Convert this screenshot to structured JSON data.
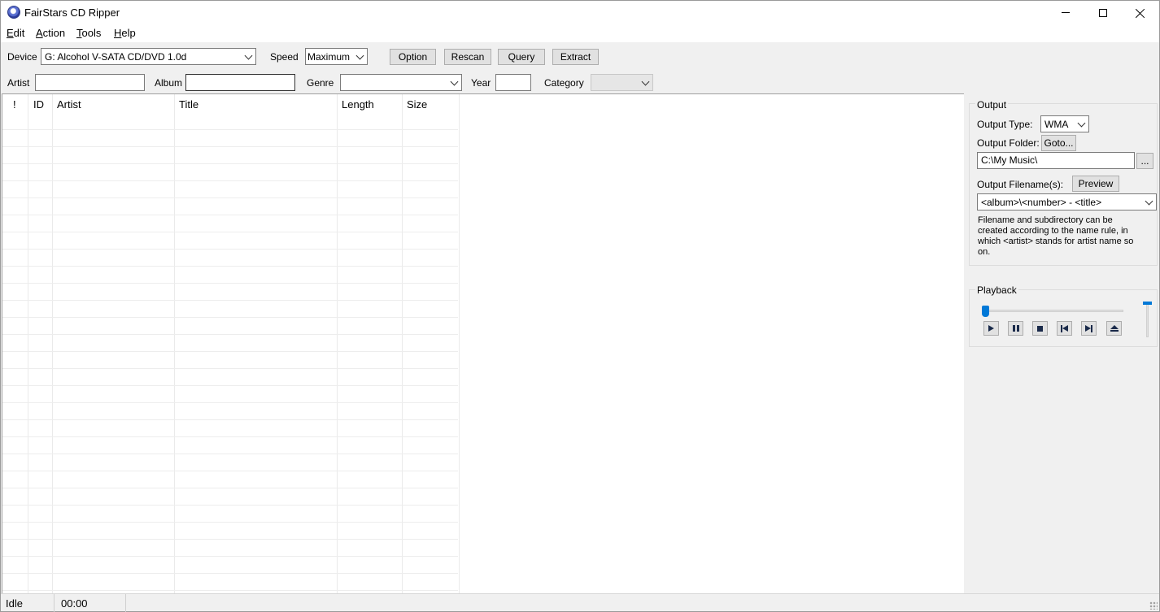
{
  "window": {
    "title": "FairStars CD Ripper"
  },
  "menu": [
    {
      "key": "E",
      "rest": "dit"
    },
    {
      "key": "A",
      "rest": "ction"
    },
    {
      "key": "T",
      "rest": "ools"
    },
    {
      "key": "H",
      "rest": "elp"
    }
  ],
  "toolbar": {
    "device_label": "Device",
    "device_value": "G: Alcohol V-SATA CD/DVD 1.0d",
    "speed_label": "Speed",
    "speed_value": "Maximum",
    "option_label": "Option",
    "rescan_label": "Rescan",
    "query_label": "Query",
    "extract_label": "Extract"
  },
  "info": {
    "artist_label": "Artist",
    "artist_value": "",
    "album_label": "Album",
    "album_value": "",
    "genre_label": "Genre",
    "genre_value": "",
    "year_label": "Year",
    "year_value": "",
    "category_label": "Category",
    "category_value": ""
  },
  "tracks": {
    "columns": [
      "!",
      "ID",
      "Artist",
      "Title",
      "Length",
      "Size"
    ],
    "rows": []
  },
  "output": {
    "group_title": "Output",
    "type_label": "Output Type:",
    "type_value": "WMA",
    "folder_label": "Output Folder:",
    "goto_label": "Goto...",
    "folder_value": "C:\\My Music\\",
    "browse_label": "...",
    "filename_label": "Output Filename(s):",
    "preview_label": "Preview",
    "filename_value": "<album>\\<number> - <title>",
    "help_text": "Filename and subdirectory can be created according to the name rule, in which <artist> stands for artist name so on."
  },
  "playback": {
    "group_title": "Playback",
    "position_fraction": 0.0,
    "volume_fraction": 1.0,
    "buttons": [
      "play-icon",
      "pause-icon",
      "stop-icon",
      "previous-track-icon",
      "next-track-icon",
      "eject-icon"
    ]
  },
  "status": {
    "state": "Idle",
    "time": "00:00"
  },
  "colors": {
    "accent": "#0078d7",
    "background": "#f0f0f0"
  }
}
